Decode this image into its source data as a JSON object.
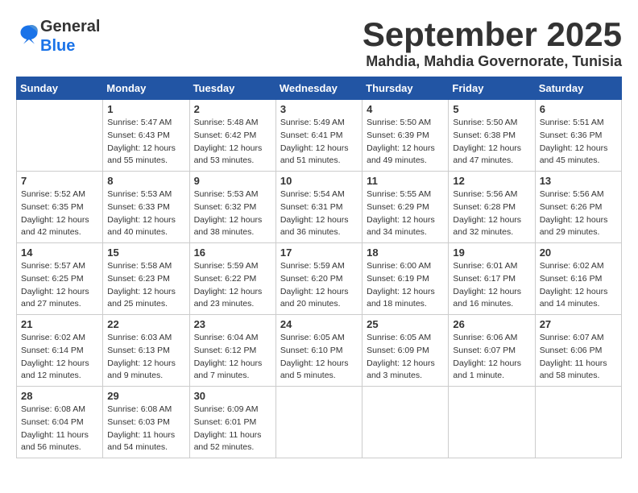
{
  "logo": {
    "text_general": "General",
    "text_blue": "Blue"
  },
  "title": {
    "month_year": "September 2025",
    "location": "Mahdia, Mahdia Governorate, Tunisia"
  },
  "weekdays": [
    "Sunday",
    "Monday",
    "Tuesday",
    "Wednesday",
    "Thursday",
    "Friday",
    "Saturday"
  ],
  "weeks": [
    [
      {
        "day": "",
        "info": ""
      },
      {
        "day": "1",
        "info": "Sunrise: 5:47 AM\nSunset: 6:43 PM\nDaylight: 12 hours\nand 55 minutes."
      },
      {
        "day": "2",
        "info": "Sunrise: 5:48 AM\nSunset: 6:42 PM\nDaylight: 12 hours\nand 53 minutes."
      },
      {
        "day": "3",
        "info": "Sunrise: 5:49 AM\nSunset: 6:41 PM\nDaylight: 12 hours\nand 51 minutes."
      },
      {
        "day": "4",
        "info": "Sunrise: 5:50 AM\nSunset: 6:39 PM\nDaylight: 12 hours\nand 49 minutes."
      },
      {
        "day": "5",
        "info": "Sunrise: 5:50 AM\nSunset: 6:38 PM\nDaylight: 12 hours\nand 47 minutes."
      },
      {
        "day": "6",
        "info": "Sunrise: 5:51 AM\nSunset: 6:36 PM\nDaylight: 12 hours\nand 45 minutes."
      }
    ],
    [
      {
        "day": "7",
        "info": "Sunrise: 5:52 AM\nSunset: 6:35 PM\nDaylight: 12 hours\nand 42 minutes."
      },
      {
        "day": "8",
        "info": "Sunrise: 5:53 AM\nSunset: 6:33 PM\nDaylight: 12 hours\nand 40 minutes."
      },
      {
        "day": "9",
        "info": "Sunrise: 5:53 AM\nSunset: 6:32 PM\nDaylight: 12 hours\nand 38 minutes."
      },
      {
        "day": "10",
        "info": "Sunrise: 5:54 AM\nSunset: 6:31 PM\nDaylight: 12 hours\nand 36 minutes."
      },
      {
        "day": "11",
        "info": "Sunrise: 5:55 AM\nSunset: 6:29 PM\nDaylight: 12 hours\nand 34 minutes."
      },
      {
        "day": "12",
        "info": "Sunrise: 5:56 AM\nSunset: 6:28 PM\nDaylight: 12 hours\nand 32 minutes."
      },
      {
        "day": "13",
        "info": "Sunrise: 5:56 AM\nSunset: 6:26 PM\nDaylight: 12 hours\nand 29 minutes."
      }
    ],
    [
      {
        "day": "14",
        "info": "Sunrise: 5:57 AM\nSunset: 6:25 PM\nDaylight: 12 hours\nand 27 minutes."
      },
      {
        "day": "15",
        "info": "Sunrise: 5:58 AM\nSunset: 6:23 PM\nDaylight: 12 hours\nand 25 minutes."
      },
      {
        "day": "16",
        "info": "Sunrise: 5:59 AM\nSunset: 6:22 PM\nDaylight: 12 hours\nand 23 minutes."
      },
      {
        "day": "17",
        "info": "Sunrise: 5:59 AM\nSunset: 6:20 PM\nDaylight: 12 hours\nand 20 minutes."
      },
      {
        "day": "18",
        "info": "Sunrise: 6:00 AM\nSunset: 6:19 PM\nDaylight: 12 hours\nand 18 minutes."
      },
      {
        "day": "19",
        "info": "Sunrise: 6:01 AM\nSunset: 6:17 PM\nDaylight: 12 hours\nand 16 minutes."
      },
      {
        "day": "20",
        "info": "Sunrise: 6:02 AM\nSunset: 6:16 PM\nDaylight: 12 hours\nand 14 minutes."
      }
    ],
    [
      {
        "day": "21",
        "info": "Sunrise: 6:02 AM\nSunset: 6:14 PM\nDaylight: 12 hours\nand 12 minutes."
      },
      {
        "day": "22",
        "info": "Sunrise: 6:03 AM\nSunset: 6:13 PM\nDaylight: 12 hours\nand 9 minutes."
      },
      {
        "day": "23",
        "info": "Sunrise: 6:04 AM\nSunset: 6:12 PM\nDaylight: 12 hours\nand 7 minutes."
      },
      {
        "day": "24",
        "info": "Sunrise: 6:05 AM\nSunset: 6:10 PM\nDaylight: 12 hours\nand 5 minutes."
      },
      {
        "day": "25",
        "info": "Sunrise: 6:05 AM\nSunset: 6:09 PM\nDaylight: 12 hours\nand 3 minutes."
      },
      {
        "day": "26",
        "info": "Sunrise: 6:06 AM\nSunset: 6:07 PM\nDaylight: 12 hours\nand 1 minute."
      },
      {
        "day": "27",
        "info": "Sunrise: 6:07 AM\nSunset: 6:06 PM\nDaylight: 11 hours\nand 58 minutes."
      }
    ],
    [
      {
        "day": "28",
        "info": "Sunrise: 6:08 AM\nSunset: 6:04 PM\nDaylight: 11 hours\nand 56 minutes."
      },
      {
        "day": "29",
        "info": "Sunrise: 6:08 AM\nSunset: 6:03 PM\nDaylight: 11 hours\nand 54 minutes."
      },
      {
        "day": "30",
        "info": "Sunrise: 6:09 AM\nSunset: 6:01 PM\nDaylight: 11 hours\nand 52 minutes."
      },
      {
        "day": "",
        "info": ""
      },
      {
        "day": "",
        "info": ""
      },
      {
        "day": "",
        "info": ""
      },
      {
        "day": "",
        "info": ""
      }
    ]
  ]
}
